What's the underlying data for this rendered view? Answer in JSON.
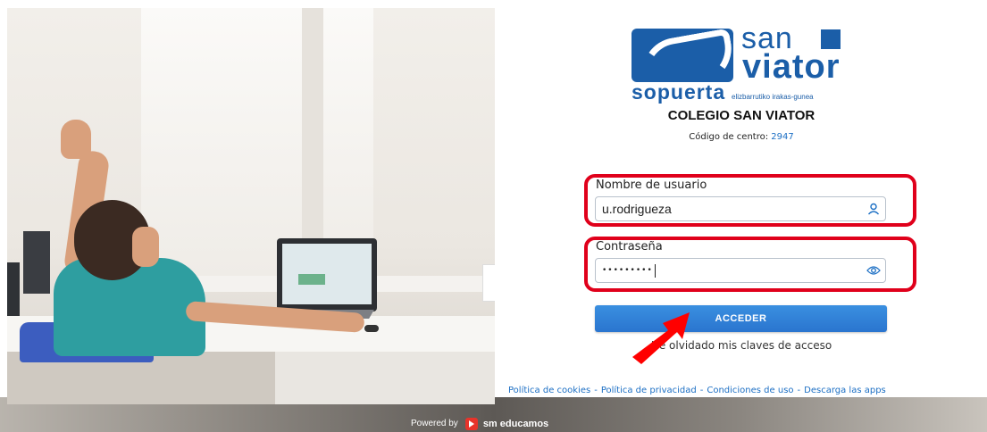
{
  "school": {
    "logo_san": "san",
    "logo_viator": "viator",
    "logo_sopuerta": "sopuerta",
    "logo_sub": "elizbarrutiko irakas-gunea",
    "name": "COLEGIO SAN VIATOR",
    "code_label": "Código de centro:",
    "code_value": "2947"
  },
  "login": {
    "username_label": "Nombre de usuario",
    "username_value": "u.rodrigueza",
    "password_label": "Contraseña",
    "password_masked": "•••••••••",
    "submit_label": "ACCEDER",
    "forgot_label": "He olvidado mis claves de acceso"
  },
  "footer": {
    "links": [
      "Política de cookies",
      "Política de privacidad",
      "Condiciones de uso",
      "Descarga las apps"
    ],
    "separator": "-",
    "powered_by": "Powered by",
    "powered_brand": "sm educamos"
  },
  "colors": {
    "brand_blue": "#1b5ea8",
    "link_blue": "#1c6fc4",
    "button_blue": "#2a75cf",
    "highlight_red": "#e0001b",
    "sm_red": "#e8332a"
  },
  "icons": {
    "username": "user-icon",
    "password": "eye-icon",
    "pointer": "red-arrow-annotation"
  }
}
